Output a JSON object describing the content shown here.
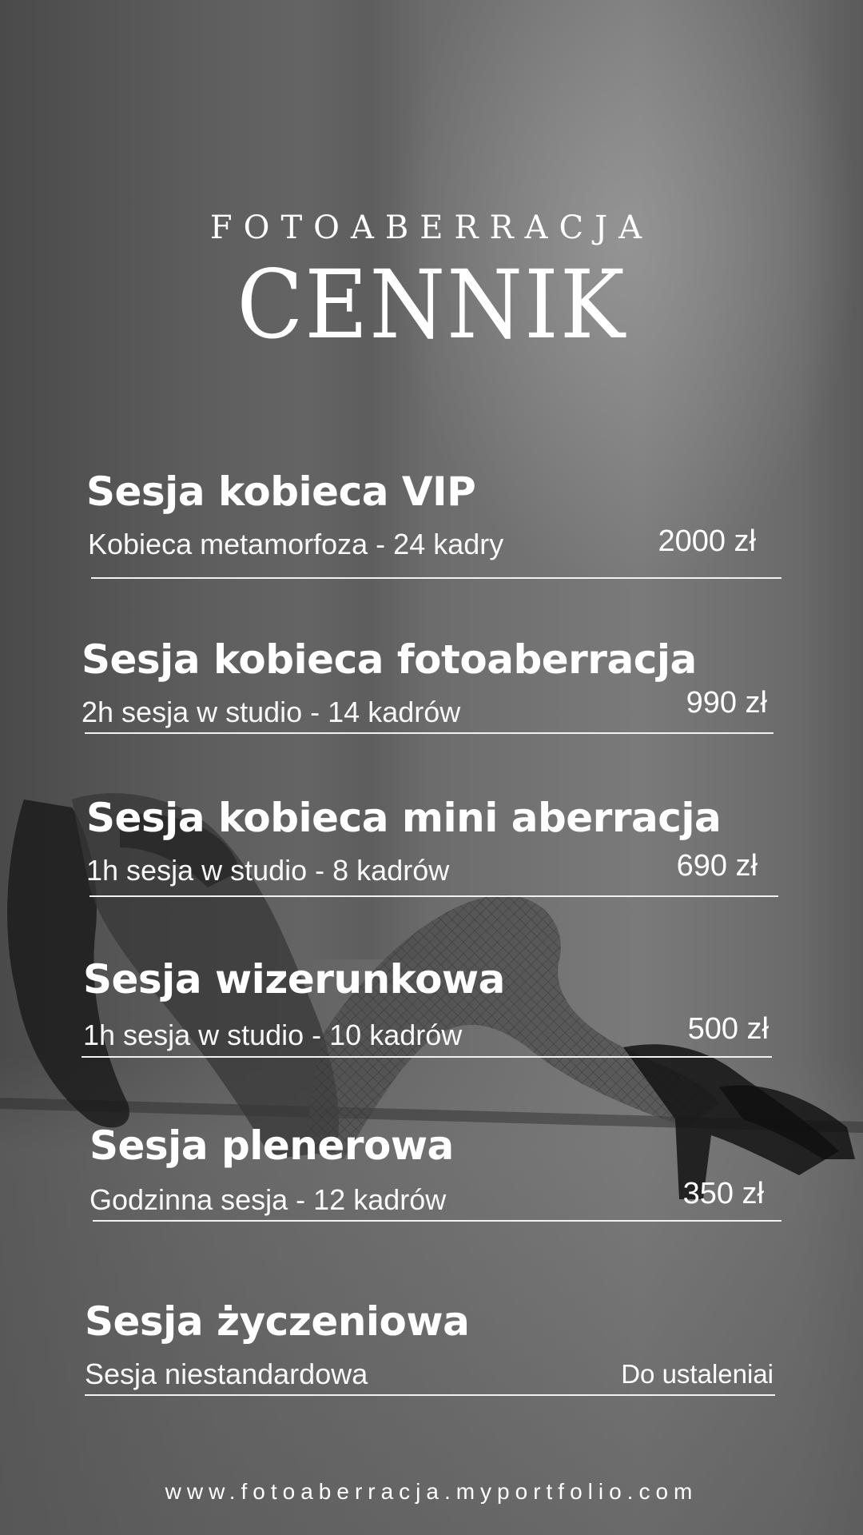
{
  "header": {
    "brand": "FOTOABERRACJA",
    "title": "CENNIK"
  },
  "items": [
    {
      "name": "Sesja kobieca VIP",
      "desc": "Kobieca metamorfoza - 24 kadry",
      "price": "2000 zł"
    },
    {
      "name": "Sesja kobieca fotoaberracja",
      "desc": "2h sesja w studio - 14 kadrów",
      "price": "990 zł"
    },
    {
      "name": "Sesja kobieca mini  aberracja",
      "desc": "1h sesja w studio - 8 kadrów",
      "price": "690 zł"
    },
    {
      "name": "Sesja wizerunkowa",
      "desc": "1h sesja w studio - 10 kadrów",
      "price": "500 zł"
    },
    {
      "name": "Sesja plenerowa",
      "desc": "Godzinna sesja - 12 kadrów",
      "price": "350 zł"
    },
    {
      "name": "Sesja życzeniowa",
      "desc": "Sesja niestandardowa",
      "price": "Do ustaleniai"
    }
  ],
  "footer": {
    "website": "www.fotoaberracja.myportfolio.com"
  },
  "colors": {
    "text": "#ffffff",
    "background": "#5a5a5a"
  }
}
